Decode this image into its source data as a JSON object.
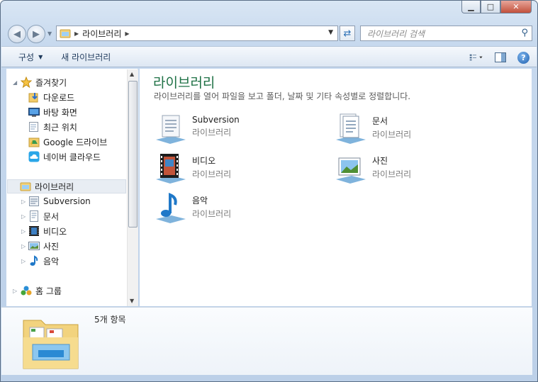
{
  "window": {
    "buttons": {
      "minimize": "▁",
      "maximize": "□",
      "close": "✕"
    }
  },
  "address": {
    "path": [
      "라이브러리"
    ],
    "search_placeholder": "라이브러리 검색"
  },
  "toolbar": {
    "organize": "구성",
    "new_library": "새 라이브러리"
  },
  "nav": {
    "favorites": {
      "label": "즐겨찾기",
      "items": [
        "다운로드",
        "바탕 화면",
        "최근 위치",
        "Google 드라이브",
        "네이버 클라우드"
      ]
    },
    "libraries": {
      "label": "라이브러리",
      "items": [
        "Subversion",
        "문서",
        "비디오",
        "사진",
        "음악"
      ]
    },
    "homegroup": "홈 그룹"
  },
  "main": {
    "title": "라이브러리",
    "subtitle": "라이브러리를 열어 파일을 보고 폴더, 날짜 및 기타 속성별로 정렬합니다.",
    "tiles": [
      {
        "name": "Subversion",
        "type": "라이브러리",
        "icon": "subversion-library-icon"
      },
      {
        "name": "문서",
        "type": "라이브러리",
        "icon": "documents-library-icon"
      },
      {
        "name": "비디오",
        "type": "라이브러리",
        "icon": "videos-library-icon"
      },
      {
        "name": "사진",
        "type": "라이브러리",
        "icon": "pictures-library-icon"
      },
      {
        "name": "음악",
        "type": "라이브러리",
        "icon": "music-library-icon"
      }
    ]
  },
  "details": {
    "count": "5개 항목"
  }
}
